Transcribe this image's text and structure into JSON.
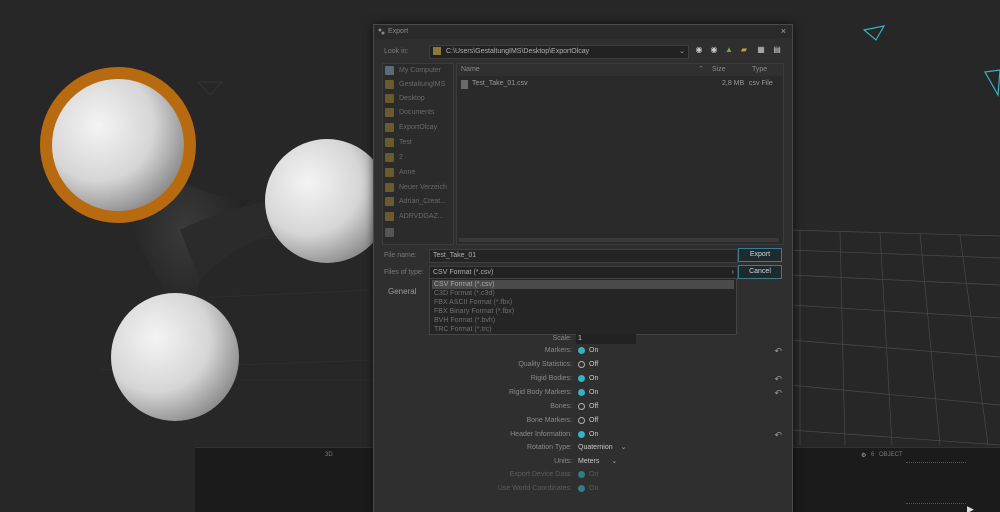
{
  "dialog": {
    "title": "Export",
    "close": "×",
    "look_in_label": "Look in:",
    "path": "C:\\Users\\GestaltungIMS\\Desktop\\ExportOlcay",
    "places": [
      "My Computer",
      "GestaltungIMS",
      "Desktop",
      "Documents",
      "ExportOlcay",
      "Test",
      "2",
      "Anne",
      "Neuer Verzeich",
      "Adrian_Creat...",
      "ADRVDGAZ..."
    ],
    "columns": {
      "name": "Name",
      "size": "Size",
      "type": "Type"
    },
    "files": [
      {
        "name": "Test_Take_01.csv",
        "size": "2,8 MB",
        "type": "csv File"
      }
    ],
    "filename_label": "File name:",
    "filename_value": "Test_Take_01",
    "filetype_label": "Files of type:",
    "filetype_value": "CSV Format (*.csv)",
    "export_button": "Export",
    "cancel_button": "Cancel",
    "general_label": "General",
    "filetype_options": [
      "CSV Format (*.csv)",
      "C3D Format (*.c3d)",
      "FBX ASCII Format (*.fbx)",
      "FBX Binary Format (*.fbx)",
      "BVH Format (*.bvh)",
      "TRC Format (*.trc)"
    ]
  },
  "settings": [
    {
      "label": "Scale:",
      "value": "1",
      "kind": "text"
    },
    {
      "label": "Markers:",
      "value": "On",
      "kind": "on",
      "reset": true
    },
    {
      "label": "Quality Statistics:",
      "value": "Off",
      "kind": "off"
    },
    {
      "label": "Rigid Bodies:",
      "value": "On",
      "kind": "on",
      "reset": true
    },
    {
      "label": "Rigid Body Markers:",
      "value": "On",
      "kind": "on",
      "reset": true
    },
    {
      "label": "Bones:",
      "value": "Off",
      "kind": "off"
    },
    {
      "label": "Bone Markers:",
      "value": "Off",
      "kind": "off"
    },
    {
      "label": "Header Information:",
      "value": "On",
      "kind": "on",
      "reset": true
    },
    {
      "label": "Rotation Type:",
      "value": "Quaternion",
      "kind": "select"
    },
    {
      "label": "Units:",
      "value": "Meters",
      "kind": "select"
    },
    {
      "label": "Export Device Data:",
      "value": "On",
      "kind": "on",
      "dim": true
    },
    {
      "label": "Use World Coordinates:",
      "value": "On",
      "kind": "on",
      "dim": true
    }
  ],
  "panels": {
    "left_label": "3D",
    "right_number": "6",
    "right_label": "OBJECT"
  },
  "colors": {
    "accent": "#2fb5c4",
    "highlight": "#e08a1a"
  }
}
